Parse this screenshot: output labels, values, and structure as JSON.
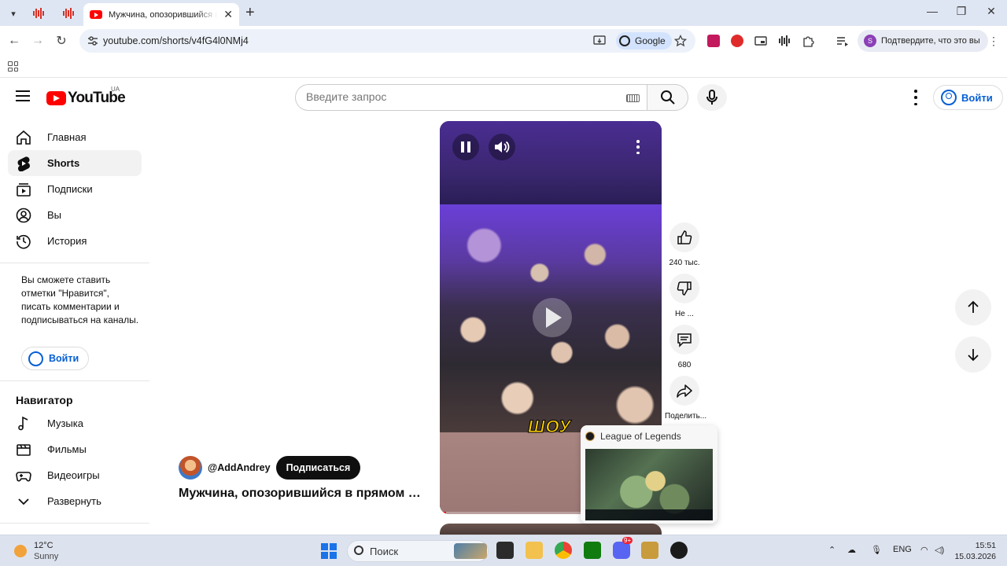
{
  "browser": {
    "tab_title": "Мужчина, опозорившийся в прямом эфире",
    "url": "youtube.com/shorts/v4fG4l0NMj4",
    "search_engine_chip": "Google",
    "profile_chip": "Подтвердите, что это вы",
    "profile_initial": "S"
  },
  "header": {
    "logo_text": "YouTube",
    "region": "UA",
    "search_placeholder": "Введите запрос",
    "signin_label": "Войти"
  },
  "sidebar": {
    "items": [
      {
        "label": "Главная",
        "icon": "home-icon"
      },
      {
        "label": "Shorts",
        "icon": "shorts-icon"
      },
      {
        "label": "Подписки",
        "icon": "subscriptions-icon"
      },
      {
        "label": "Вы",
        "icon": "you-icon"
      },
      {
        "label": "История",
        "icon": "history-icon"
      }
    ],
    "signin_note": "Вы сможете ставить отметки \"Нравится\", писать комментарии и подписываться на каналы.",
    "signin_label": "Войти",
    "explore_title": "Навигатор",
    "explore_items": [
      {
        "label": "Музыка",
        "icon": "music-icon"
      },
      {
        "label": "Фильмы",
        "icon": "movies-icon"
      },
      {
        "label": "Видеоигры",
        "icon": "gaming-icon"
      },
      {
        "label": "Развернуть",
        "icon": "chevron-down-icon"
      }
    ]
  },
  "short": {
    "caption_overlay": "ШОУ",
    "channel": "@AddAndrey",
    "subscribe_label": "Подписаться",
    "title": "Мужчина, опозорившийся в прямом эфире",
    "progress": 0.03,
    "actions": {
      "likes": "240 тыс.",
      "dislike_label": "Не ...",
      "comments": "680",
      "share_label": "Поделить..."
    }
  },
  "hover_preview": {
    "title": "League of Legends"
  },
  "taskbar": {
    "temp": "12°C",
    "weather": "Sunny",
    "search_label": "Поиск",
    "lang": "ENG",
    "time": "15:51",
    "date": "15.03.2026",
    "discord_badge": "9+"
  },
  "colors": {
    "accent": "#065fd4",
    "youtube_red": "#ff0000"
  }
}
